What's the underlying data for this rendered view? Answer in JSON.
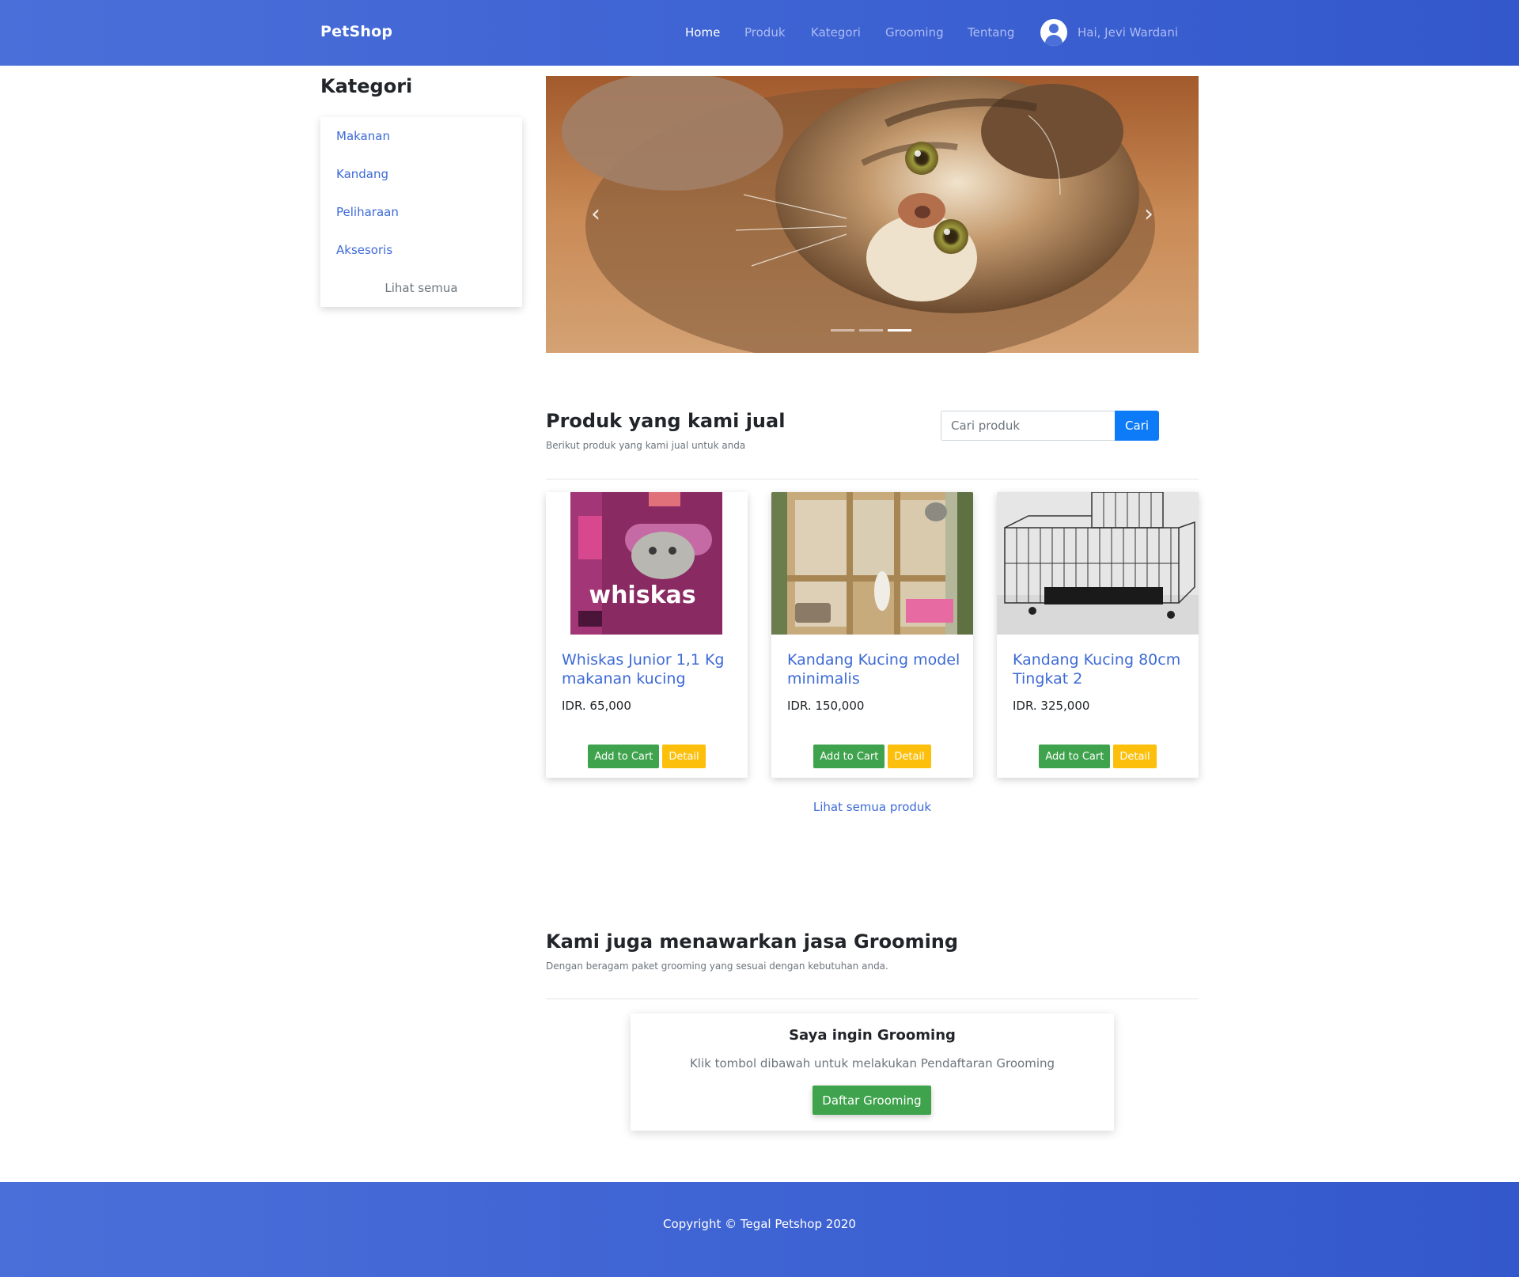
{
  "navbar": {
    "brand": "PetShop",
    "links": [
      "Home",
      "Produk",
      "Kategori",
      "Grooming",
      "Tentang"
    ],
    "active": "Home",
    "user_greeting": "Hai, Jevi Wardani"
  },
  "sidebar": {
    "title": "Kategori",
    "items": [
      "Makanan",
      "Kandang",
      "Peliharaan",
      "Aksesoris"
    ],
    "see_all": "Lihat semua"
  },
  "carousel": {
    "icon_prev": "chevron-left-icon",
    "icon_next": "chevron-right-icon",
    "slide_count": 3,
    "active_slide": 3
  },
  "products": {
    "title": "Produk yang kami jual",
    "subtitle": "Berikut produk yang kami jual untuk anda",
    "search": {
      "placeholder": "Cari produk",
      "button": "Cari"
    },
    "items": [
      {
        "name": "Whiskas Junior 1,1 Kg makanan kucing",
        "price": "IDR. 65,000",
        "cart_label": "Add to Cart",
        "detail_label": "Detail"
      },
      {
        "name": "Kandang Kucing model minimalis",
        "price": "IDR. 150,000",
        "cart_label": "Add to Cart",
        "detail_label": "Detail"
      },
      {
        "name": "Kandang Kucing 80cm Tingkat 2",
        "price": "IDR. 325,000",
        "cart_label": "Add to Cart",
        "detail_label": "Detail"
      }
    ],
    "see_all": "Lihat semua produk"
  },
  "grooming": {
    "title": "Kami juga menawarkan jasa Grooming",
    "subtitle": "Dengan beragam paket grooming yang sesuai dengan kebutuhan anda.",
    "card_title": "Saya ingin Grooming",
    "card_text": "Klik tombol dibawah untuk melakukan Pendaftaran Grooming",
    "button": "Daftar Grooming"
  },
  "footer": {
    "copyright": "Copyright © Tegal Petshop 2020"
  },
  "colors": {
    "primary": "#3e63d3",
    "link": "#3d6ad6",
    "success": "#3fa34d",
    "warning": "#fbbf0c",
    "search_button": "#0d7bf7"
  }
}
